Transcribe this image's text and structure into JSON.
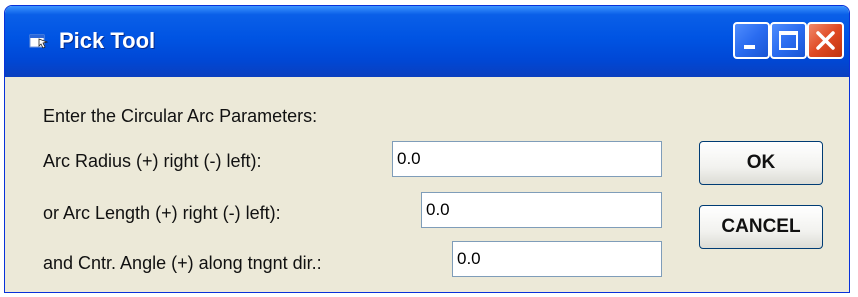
{
  "window": {
    "title": "Pick Tool",
    "icon": "app-icon"
  },
  "titlebar": {
    "buttons": [
      "minimize-icon",
      "maximize-icon",
      "close-icon"
    ]
  },
  "form": {
    "heading": "Enter the Circular Arc Parameters:",
    "fields": [
      {
        "label": "Arc Radius (+) right (-) left):",
        "value": "0.0"
      },
      {
        "label": "or Arc Length (+) right (-) left):",
        "value": "0.0"
      },
      {
        "label": "and Cntr. Angle (+) along tngnt dir.:",
        "value": "0.0"
      }
    ]
  },
  "actions": {
    "ok_label": "OK",
    "cancel_label": "CANCEL"
  },
  "colors": {
    "titlebar": "#0054e3",
    "dialog_bg": "#ece9d8",
    "close_button": "#e04a24"
  }
}
